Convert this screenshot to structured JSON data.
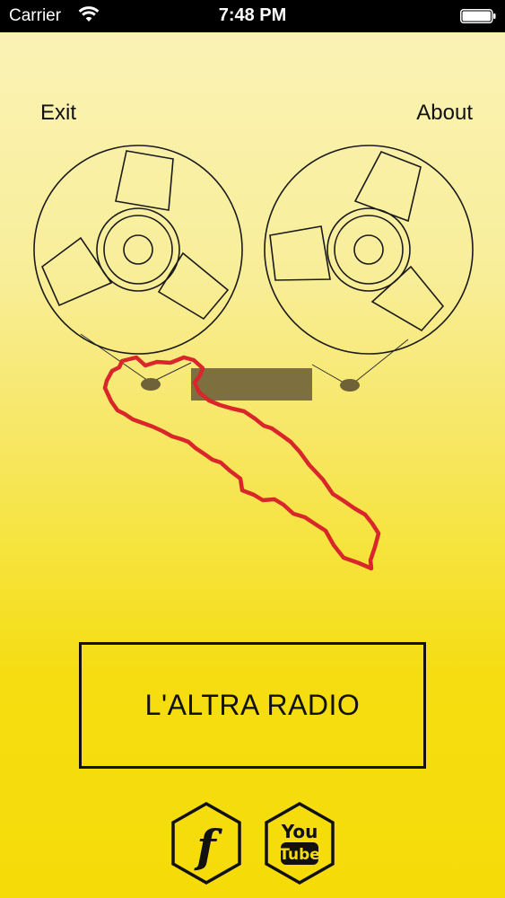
{
  "status_bar": {
    "carrier": "Carrier",
    "time": "7:48 PM"
  },
  "nav": {
    "exit_label": "Exit",
    "about_label": "About"
  },
  "main": {
    "radio_button_label": "L'ALTRA RADIO"
  },
  "social": {
    "facebook_glyph": "f",
    "youtube_top": "You",
    "youtube_bottom": "Tube"
  },
  "colors": {
    "accent_red": "#d8262a",
    "tape_window": "#6f6239",
    "line": "#1a1a1a"
  }
}
